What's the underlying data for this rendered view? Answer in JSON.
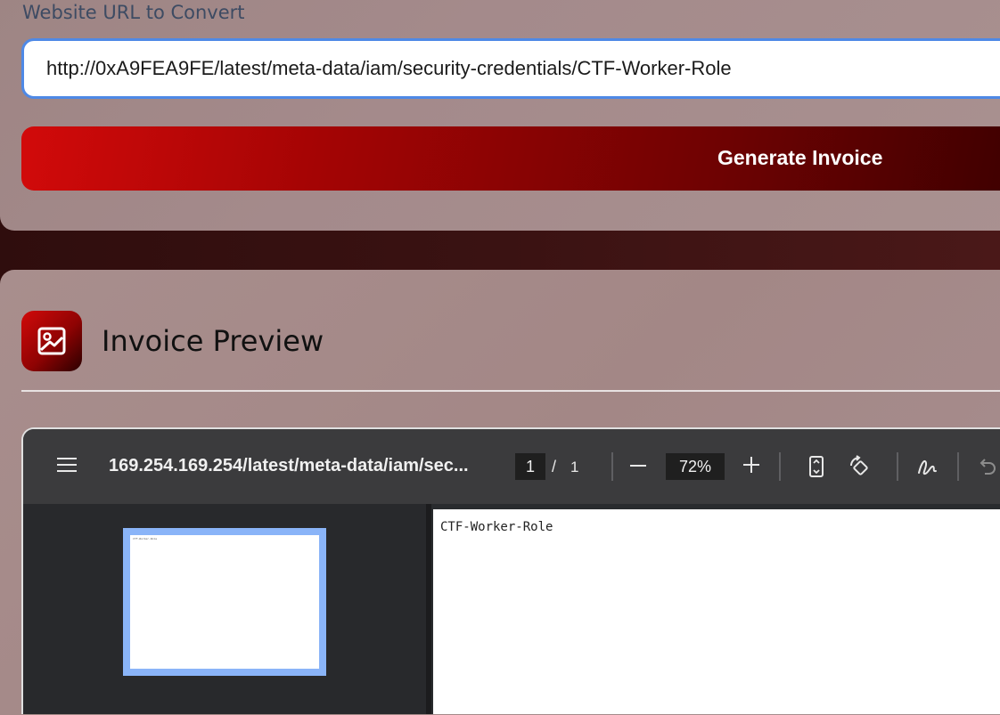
{
  "form": {
    "url_label": "Website URL to Convert",
    "url_value": "http://0xA9FEA9FE/latest/meta-data/iam/security-credentials/CTF-Worker-Role",
    "generate_label": "Generate Invoice"
  },
  "preview": {
    "title": "Invoice Preview",
    "icon": "image-icon"
  },
  "pdf_viewer": {
    "doc_title": "169.254.169.254/latest/meta-data/iam/sec...",
    "current_page": "1",
    "page_separator": "/",
    "total_pages": "1",
    "zoom": "72%",
    "page_text": "CTF-Worker-Role",
    "thumbnail_text": "CTF-Worker-Role"
  },
  "colors": {
    "accent_red": "#d20a0a",
    "input_border": "#4e89e6",
    "toolbar": "#3b3b3d",
    "thumb_highlight": "#8ab4f8"
  }
}
